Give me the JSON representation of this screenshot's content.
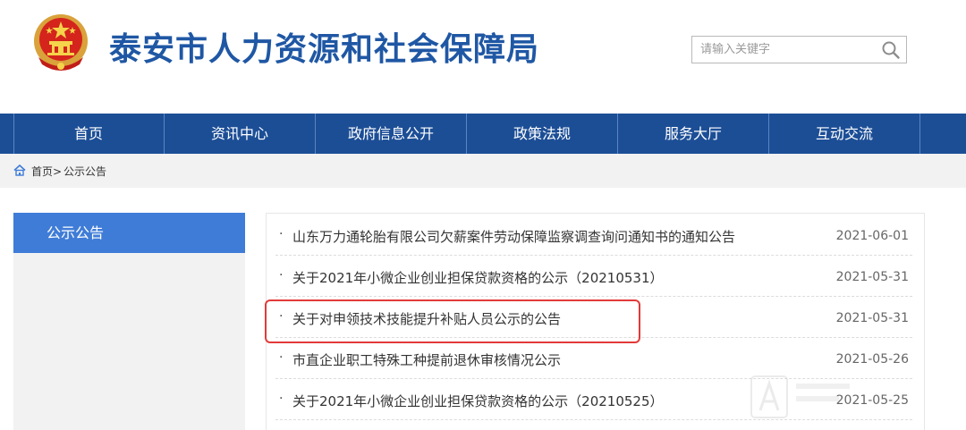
{
  "header": {
    "site_title": "泰安市人力资源和社会保障局"
  },
  "search": {
    "placeholder": "请输入关键字"
  },
  "nav": {
    "items": [
      {
        "label": "首页"
      },
      {
        "label": "资讯中心"
      },
      {
        "label": "政府信息公开"
      },
      {
        "label": "政策法规"
      },
      {
        "label": "服务大厅"
      },
      {
        "label": "互动交流"
      }
    ]
  },
  "breadcrumb": {
    "home": "首页>",
    "current": "公示公告"
  },
  "sidebar": {
    "heading": "公示公告"
  },
  "list": {
    "bullet": "·",
    "items": [
      {
        "title": "山东万力通轮胎有限公司欠薪案件劳动保障监察调查询问通知书的通知公告",
        "date": "2021-06-01"
      },
      {
        "title": "关于2021年小微企业创业担保贷款资格的公示（20210531）",
        "date": "2021-05-31"
      },
      {
        "title": "关于对申领技术技能提升补贴人员公示的公告",
        "date": "2021-05-31"
      },
      {
        "title": "市直企业职工特殊工种提前退休审核情况公示",
        "date": "2021-05-26"
      },
      {
        "title": "关于2021年小微企业创业担保贷款资格的公示（20210525）",
        "date": "2021-05-25"
      }
    ]
  },
  "colors": {
    "brand_blue": "#1f57a4",
    "nav_bg": "#1c4e96",
    "sidebar_active": "#3f7cd7",
    "highlight_border": "#e23a3a"
  }
}
